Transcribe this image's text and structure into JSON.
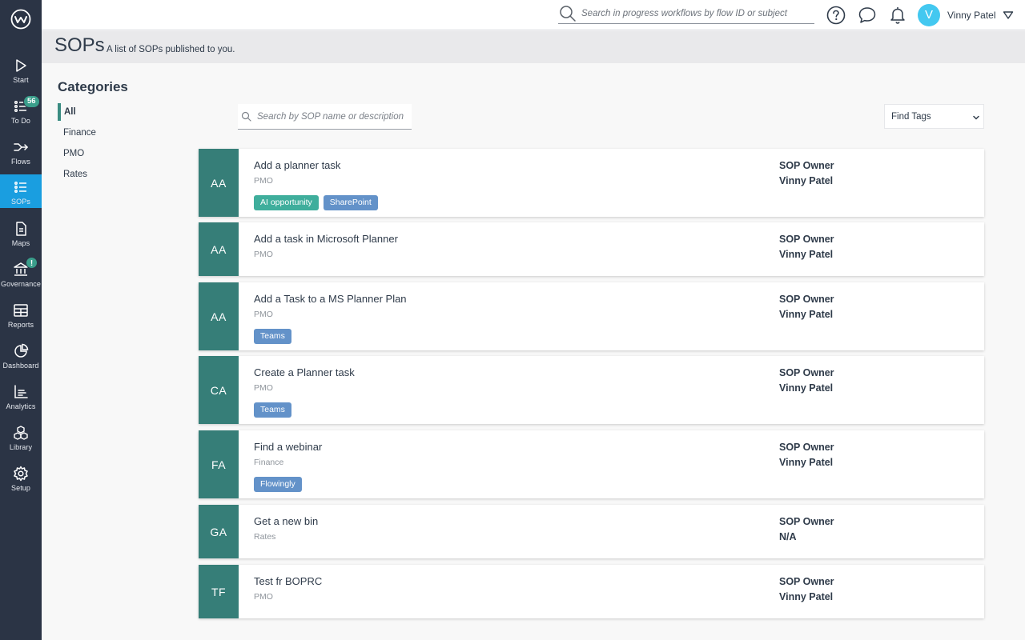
{
  "nav": {
    "items": [
      {
        "label": "Start",
        "icon": "play-icon"
      },
      {
        "label": "To Do",
        "icon": "checklist-icon",
        "badge": "56"
      },
      {
        "label": "Flows",
        "icon": "flows-icon"
      },
      {
        "label": "SOPs",
        "icon": "list-icon",
        "active": true
      },
      {
        "label": "Maps",
        "icon": "document-icon"
      },
      {
        "label": "Governance",
        "icon": "bank-icon",
        "alert": "!"
      },
      {
        "label": "Reports",
        "icon": "table-icon"
      },
      {
        "label": "Dashboard",
        "icon": "pie-chart-icon"
      },
      {
        "label": "Analytics",
        "icon": "line-chart-icon"
      },
      {
        "label": "Library",
        "icon": "boxes-icon"
      },
      {
        "label": "Setup",
        "icon": "gear-icon"
      }
    ]
  },
  "topbar": {
    "search_placeholder": "Search in progress workflows by flow ID or subject",
    "avatar_initial": "V",
    "user_name": "Vinny Patel"
  },
  "header": {
    "title": "SOPs",
    "subtitle": "A list of SOPs published to you."
  },
  "categories": {
    "title": "Categories",
    "items": [
      "All",
      "Finance",
      "PMO",
      "Rates"
    ],
    "selected": "All"
  },
  "sop_search": {
    "placeholder": "Search by SOP name or description"
  },
  "tag_filter": {
    "selected": "Find Tags"
  },
  "colors": {
    "accent_teal": "#367e78",
    "active_nav": "#1a9ee0",
    "tag_teal": "#3fae9c",
    "tag_blue": "#6392c9"
  },
  "sops": [
    {
      "initials": "AA",
      "title": "Add a planner task",
      "category": "PMO",
      "tags": [
        {
          "label": "AI opportunity",
          "color": "#3fae9c"
        },
        {
          "label": "SharePoint",
          "color": "#6392c9"
        }
      ],
      "owner_label": "SOP Owner",
      "owner": "Vinny Patel"
    },
    {
      "initials": "AA",
      "title": "Add a task in Microsoft Planner",
      "category": "PMO",
      "tags": [],
      "owner_label": "SOP Owner",
      "owner": "Vinny Patel"
    },
    {
      "initials": "AA",
      "title": "Add a Task to a MS Planner Plan",
      "category": "PMO",
      "tags": [
        {
          "label": "Teams",
          "color": "#6392c9"
        }
      ],
      "owner_label": "SOP Owner",
      "owner": "Vinny Patel"
    },
    {
      "initials": "CA",
      "title": "Create a Planner task",
      "category": "PMO",
      "tags": [
        {
          "label": "Teams",
          "color": "#6392c9"
        }
      ],
      "owner_label": "SOP Owner",
      "owner": "Vinny Patel"
    },
    {
      "initials": "FA",
      "title": "Find a webinar",
      "category": "Finance",
      "tags": [
        {
          "label": "Flowingly",
          "color": "#6392c9"
        }
      ],
      "owner_label": "SOP Owner",
      "owner": "Vinny Patel"
    },
    {
      "initials": "GA",
      "title": "Get a new bin",
      "category": "Rates",
      "tags": [],
      "owner_label": "SOP Owner",
      "owner": "N/A"
    },
    {
      "initials": "TF",
      "title": "Test fr BOPRC",
      "category": "PMO",
      "tags": [],
      "owner_label": "SOP Owner",
      "owner": "Vinny Patel"
    }
  ]
}
